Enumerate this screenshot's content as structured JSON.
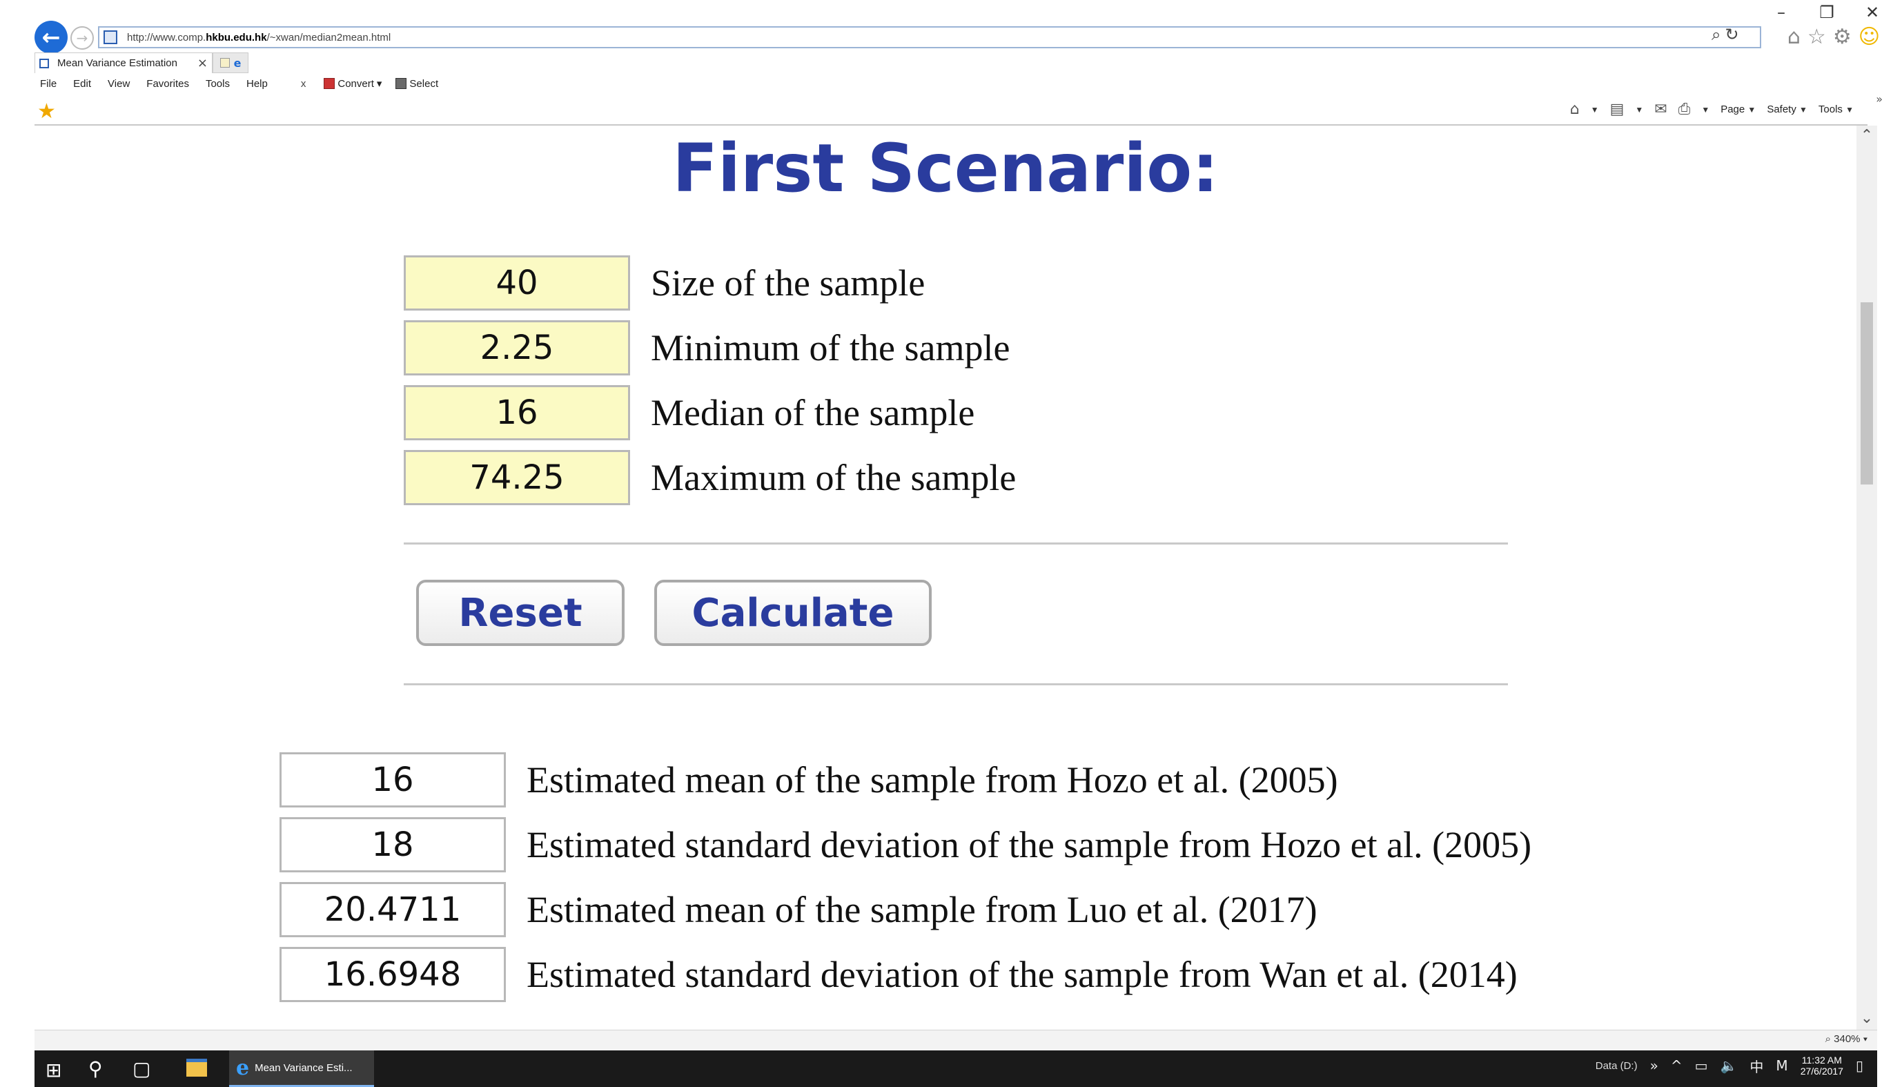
{
  "browser": {
    "url_prefix": "http://www.comp.",
    "url_host": "hkbu.edu.hk",
    "url_path": "/~xwan/median2mean.html",
    "tab_title": "Mean Variance Estimation",
    "tab_close": "×",
    "menu": [
      "File",
      "Edit",
      "View",
      "Favorites",
      "Tools",
      "Help"
    ],
    "toolbar_close": "x",
    "convert_label": "Convert",
    "select_label": "Select",
    "command_bar": {
      "page": "Page",
      "safety": "Safety",
      "tools": "Tools"
    },
    "zoom": "340%"
  },
  "page": {
    "title": "First Scenario:",
    "inputs": [
      {
        "value": "40",
        "label": "Size of the sample"
      },
      {
        "value": "2.25",
        "label": "Minimum of the sample"
      },
      {
        "value": "16",
        "label": "Median of the sample"
      },
      {
        "value": "74.25",
        "label": "Maximum of the sample"
      }
    ],
    "buttons": {
      "reset": "Reset",
      "calculate": "Calculate"
    },
    "outputs": [
      {
        "value": "16",
        "label": "Estimated mean of the sample from Hozo et al. (2005)"
      },
      {
        "value": "18",
        "label": "Estimated standard deviation of the sample from Hozo et al. (2005)"
      },
      {
        "value": "20.4711",
        "label": "Estimated mean of the sample from Luo et al. (2017)"
      },
      {
        "value": "16.6948",
        "label": "Estimated standard deviation of the sample from Wan et al. (2014)"
      }
    ]
  },
  "taskbar": {
    "app_label": "Mean Variance Esti...",
    "tray_drive": "Data (D:)",
    "time": "11:32 AM",
    "date": "27/6/2017"
  },
  "colors": {
    "title_blue": "#2a3c9e",
    "input_fill": "#fbfac4",
    "box_border": "#b8b8b8"
  }
}
